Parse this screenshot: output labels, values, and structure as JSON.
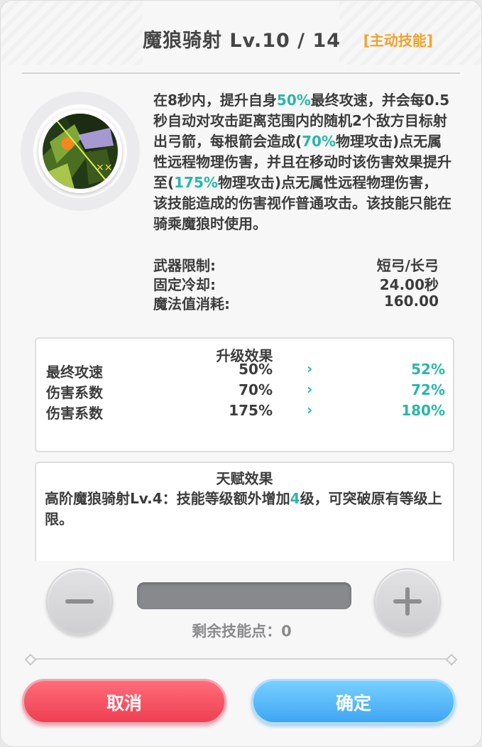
{
  "header": {
    "title": "魔狼骑射 Lv.10 / 14",
    "tag": "[主动技能]"
  },
  "skill": {
    "icon": "wolf-archer-skill-icon",
    "description": [
      {
        "text": "在8秒内，提升自身",
        "hl": false
      },
      {
        "text": "50%",
        "hl": true
      },
      {
        "text": "最终攻速，并会每0.5秒自动对攻击距离范围内的随机2个敌方目标射出弓箭，每根箭会造成(",
        "hl": false
      },
      {
        "text": "70%",
        "hl": true
      },
      {
        "text": "物理攻击)点无属性远程物理伤害，并且在移动时该伤害效果提升至(",
        "hl": false
      },
      {
        "text": "175%",
        "hl": true
      },
      {
        "text": "物理攻击)点无属性远程物理伤害，该技能造成的伤害视作普通攻击。该技能只能在骑乘魔狼时使用。",
        "hl": false
      }
    ],
    "stats": [
      {
        "label": "武器限制:",
        "value": "短弓/长弓"
      },
      {
        "label": "固定冷却:",
        "value": "24.00秒"
      },
      {
        "label": "魔法值消耗:",
        "value": "160.00"
      }
    ]
  },
  "upgrade": {
    "title": "升级效果",
    "rows": [
      {
        "name": "最终攻速",
        "from": "50%",
        "arrow": "›",
        "to": "52%"
      },
      {
        "name": "伤害系数",
        "from": "70%",
        "arrow": "›",
        "to": "72%"
      },
      {
        "name": "伤害系数",
        "from": "175%",
        "arrow": "›",
        "to": "180%"
      }
    ]
  },
  "talent": {
    "title": "天赋效果",
    "text_before": "高阶魔狼骑射Lv.4：技能等级额外增加",
    "highlight": "4",
    "text_after": "级，可突破原有等级上限。"
  },
  "controls": {
    "minus_icon": "minus-icon",
    "plus_icon": "plus-icon",
    "points_label": "剩余技能点：0"
  },
  "footer": {
    "cancel_label": "取消",
    "confirm_label": "确定"
  },
  "colors": {
    "highlight": "#2bb6a8",
    "tag": "#f0a22c",
    "cancel": "#ee3f52",
    "confirm": "#3fa6f3"
  }
}
